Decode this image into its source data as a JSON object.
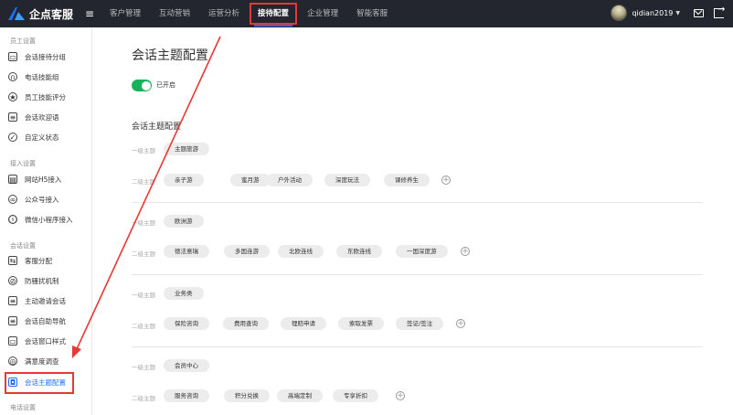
{
  "brand": {
    "name": "企点客服"
  },
  "nav": {
    "items": [
      "客户管理",
      "互动营销",
      "运营分析",
      "接待配置",
      "企业管理",
      "智能客服"
    ],
    "active_index": 3
  },
  "user": {
    "name": "qidian2019"
  },
  "sidebar": {
    "sections": [
      {
        "title": "员工设置",
        "items": [
          "会话接待分组",
          "电话技能组",
          "员工技能评分",
          "会话欢迎语",
          "自定义状态"
        ]
      },
      {
        "title": "接入设置",
        "items": [
          "网站H5接入",
          "公众号接入",
          "微信小程序接入"
        ]
      },
      {
        "title": "会话设置",
        "items": [
          "客服分配",
          "防骚扰机制",
          "主动邀请会话",
          "会话自助导航",
          "会话窗口样式",
          "满意度调查",
          "会话主题配置"
        ]
      },
      {
        "title": "电话设置",
        "items": []
      }
    ],
    "active_item": "会话主题配置"
  },
  "page": {
    "title": "会话主题配置",
    "toggle_label": "已开启",
    "toggle_on": true,
    "section_title": "会话主题配置",
    "level1_label": "一级主题",
    "level2_label": "二级主题",
    "groups": [
      {
        "level1": "主题旅游",
        "level2": [
          "亲子游",
          "蜜月游",
          "户外活动",
          "深度玩法",
          "课修养生"
        ]
      },
      {
        "level1": "欧洲游",
        "level2": [
          "德法意瑞",
          "多国连游",
          "北欧连线",
          "东欧连线",
          "一国深度游"
        ]
      },
      {
        "level1": "业务类",
        "level2": [
          "保险咨询",
          "费用查询",
          "理赔申请",
          "索取发票",
          "签证/签注"
        ]
      },
      {
        "level1": "会员中心",
        "level2": [
          "服务咨询",
          "积分兑换",
          "高端定制",
          "专享折扣"
        ]
      }
    ]
  },
  "colors": {
    "topbar": "#23262e",
    "accent": "#1e6fff",
    "toggle": "#16b35c",
    "annotation": "#e53935"
  }
}
